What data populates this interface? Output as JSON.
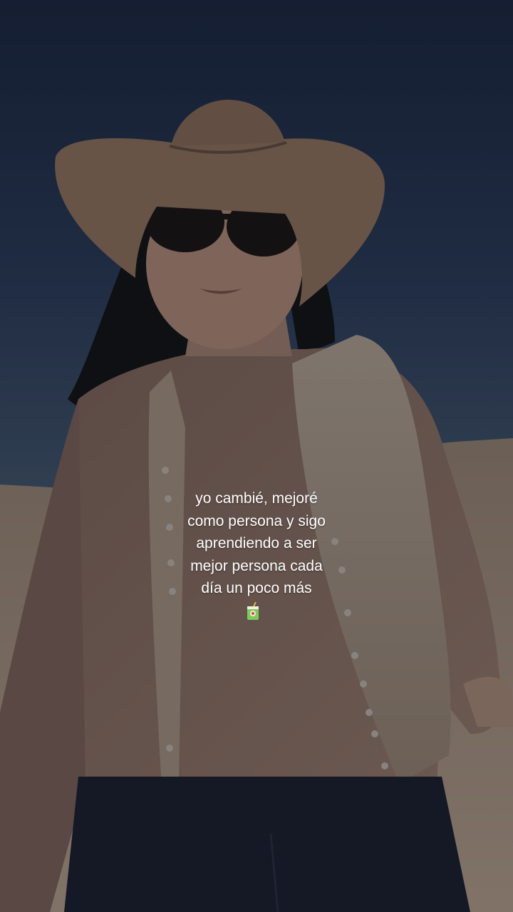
{
  "caption": {
    "lines": [
      "yo cambié, mejoré",
      "como persona y sigo",
      "aprendiendo a ser",
      "mejor persona cada",
      "día un poco más"
    ],
    "emoji": "juice-box-emoji"
  },
  "colors": {
    "sky_top": "#1f2d4a",
    "sky_bottom": "#3b5372",
    "sand": "#b59f8a",
    "shirt": "#9b7c6e",
    "vest": "#b3a08f",
    "hat": "#a07d66",
    "jeans": "#1e2230",
    "hair": "#141414"
  }
}
